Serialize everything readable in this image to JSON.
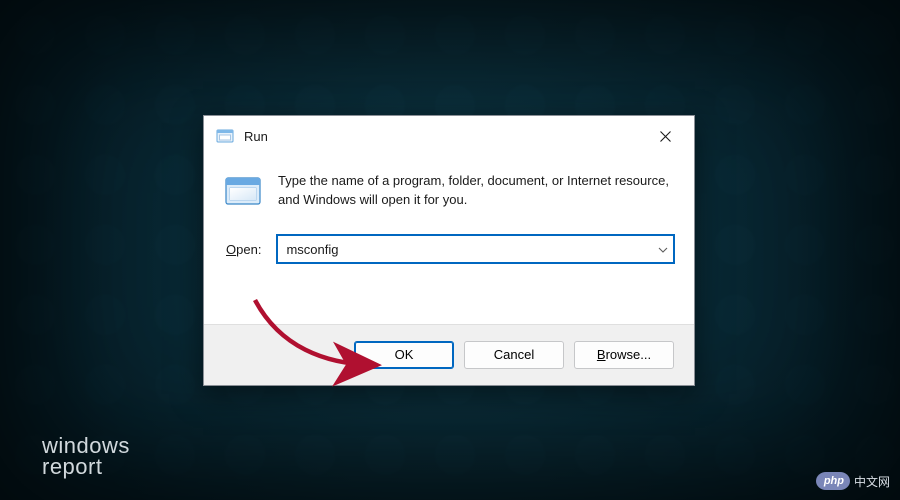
{
  "dialog": {
    "title": "Run",
    "instruction": "Type the name of a program, folder, document, or Internet resource, and Windows will open it for you.",
    "open_label_ul": "O",
    "open_label_rest": "pen:",
    "input_value": "msconfig",
    "buttons": {
      "ok": "OK",
      "cancel": "Cancel",
      "browse_ul": "B",
      "browse_rest": "rowse..."
    }
  },
  "watermarks": {
    "wr_line1": "windows",
    "wr_line2": "report",
    "php_logo": "php",
    "php_cn": "中文网"
  }
}
